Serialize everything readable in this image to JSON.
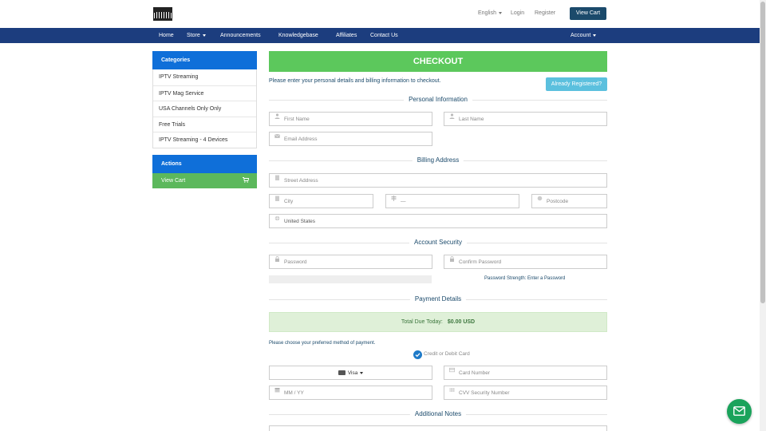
{
  "header": {
    "language": "English",
    "login": "Login",
    "register": "Register",
    "view_cart": "View Cart"
  },
  "nav": {
    "items": [
      {
        "label": "Home"
      },
      {
        "label": "Store"
      },
      {
        "label": "Announcements"
      },
      {
        "label": "Knowledgebase"
      },
      {
        "label": "Affiliates"
      },
      {
        "label": "Contact Us"
      }
    ],
    "account": "Account"
  },
  "sidebar": {
    "categories_title": "Categories",
    "categories": [
      "IPTV Streaming",
      "IPTV Mag Service",
      "USA Channels Only Only",
      "Free Trials",
      "IPTV Streaming - 4 Devices"
    ],
    "actions_title": "Actions",
    "view_cart": "View Cart"
  },
  "checkout": {
    "title": "CHECKOUT",
    "intro": "Please enter your personal details and billing information to checkout.",
    "already_registered": "Already Registered?",
    "personal_title": "Personal Information",
    "first_name": "First Name",
    "last_name": "Last Name",
    "email": "Email Address",
    "billing_title": "Billing Address",
    "street": "Street Address",
    "city": "City",
    "state": "—",
    "postcode": "Postcode",
    "country": "United States",
    "security_title": "Account Security",
    "password": "Password",
    "confirm_password": "Confirm Password",
    "password_strength": "Password Strength: Enter a Password",
    "payment_title": "Payment Details",
    "total_label": "Total Due Today:",
    "total_value": "$0.00 USD",
    "choose_method": "Please choose your preferred method of payment.",
    "method": "Credit or Debit Card",
    "card_type": "Visa",
    "card_number": "Card Number",
    "expiry": "MM / YY",
    "cvv": "CVV Security Number",
    "notes_title": "Additional Notes"
  },
  "colors": {
    "nav": "#1c3d7e",
    "sidebar_head": "#0f6fd9",
    "checkout": "#5cc85c",
    "chat": "#1aa35b"
  }
}
